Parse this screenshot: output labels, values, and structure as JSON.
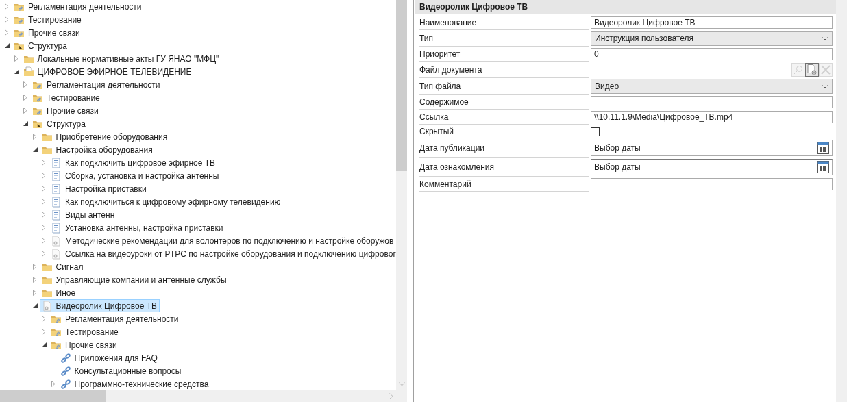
{
  "tree": [
    {
      "label": "Регламентация деятельности",
      "kind": "folder-link",
      "expandable": true,
      "expanded": false,
      "selected": false
    },
    {
      "label": "Тестирование",
      "kind": "folder-link",
      "expandable": true,
      "expanded": false,
      "selected": false
    },
    {
      "label": "Прочие связи",
      "kind": "folder-link",
      "expandable": true,
      "expanded": false,
      "selected": false
    },
    {
      "label": "Структура",
      "kind": "folder-struct",
      "expandable": true,
      "expanded": true,
      "selected": false,
      "children": [
        {
          "label": "Локальные нормативные акты ГУ ЯНАО \"МФЦ\"",
          "kind": "folder",
          "expandable": true,
          "expanded": false,
          "selected": false
        },
        {
          "label": "ЦИФРОВОЕ ЭФИРНОЕ ТЕЛЕВИДЕНИЕ",
          "kind": "folder-doc",
          "expandable": true,
          "expanded": true,
          "selected": false,
          "children": [
            {
              "label": "Регламентация деятельности",
              "kind": "folder-link",
              "expandable": true,
              "expanded": false,
              "selected": false
            },
            {
              "label": "Тестирование",
              "kind": "folder-link",
              "expandable": true,
              "expanded": false,
              "selected": false
            },
            {
              "label": "Прочие связи",
              "kind": "folder-link",
              "expandable": true,
              "expanded": false,
              "selected": false
            },
            {
              "label": "Структура",
              "kind": "folder-struct",
              "expandable": true,
              "expanded": true,
              "selected": false,
              "children": [
                {
                  "label": "Приобретение оборудования",
                  "kind": "folder",
                  "expandable": true,
                  "expanded": false,
                  "selected": false
                },
                {
                  "label": "Настройка оборудования",
                  "kind": "folder",
                  "expandable": true,
                  "expanded": true,
                  "selected": false,
                  "children": [
                    {
                      "label": "Как подключить цифровое эфирное ТВ",
                      "kind": "document",
                      "expandable": true,
                      "expanded": false,
                      "selected": false
                    },
                    {
                      "label": "Сборка, установка и настройка антенны",
                      "kind": "document",
                      "expandable": true,
                      "expanded": false,
                      "selected": false
                    },
                    {
                      "label": "Настройка приставки",
                      "kind": "document",
                      "expandable": true,
                      "expanded": false,
                      "selected": false
                    },
                    {
                      "label": "Как подключиться к цифровому эфирному телевидению",
                      "kind": "document",
                      "expandable": true,
                      "expanded": false,
                      "selected": false
                    },
                    {
                      "label": "Виды антенн",
                      "kind": "document",
                      "expandable": true,
                      "expanded": false,
                      "selected": false
                    },
                    {
                      "label": "Установка антенны, настройка приставки",
                      "kind": "document",
                      "expandable": true,
                      "expanded": false,
                      "selected": false
                    },
                    {
                      "label": "Методические рекомендации для волонтеров по подключению и настройке оборужов",
                      "kind": "media",
                      "expandable": true,
                      "expanded": false,
                      "selected": false
                    },
                    {
                      "label": "Ссылка на видеоуроки от РТРС по настройке оборудования и подключению цифровог",
                      "kind": "media",
                      "expandable": true,
                      "expanded": false,
                      "selected": false
                    }
                  ]
                },
                {
                  "label": "Сигнал",
                  "kind": "folder",
                  "expandable": true,
                  "expanded": false,
                  "selected": false
                },
                {
                  "label": "Управляющие компании и антенные службы",
                  "kind": "folder",
                  "expandable": true,
                  "expanded": false,
                  "selected": false
                },
                {
                  "label": "Иное",
                  "kind": "folder",
                  "expandable": true,
                  "expanded": false,
                  "selected": false
                },
                {
                  "label": "Видеоролик Цифровое ТВ",
                  "kind": "media",
                  "expandable": true,
                  "expanded": true,
                  "selected": true,
                  "children": [
                    {
                      "label": "Регламентация деятельности",
                      "kind": "folder-link",
                      "expandable": true,
                      "expanded": false,
                      "selected": false
                    },
                    {
                      "label": "Тестирование",
                      "kind": "folder-link",
                      "expandable": true,
                      "expanded": false,
                      "selected": false
                    },
                    {
                      "label": "Прочие связи",
                      "kind": "folder-link",
                      "expandable": true,
                      "expanded": true,
                      "selected": false,
                      "children": [
                        {
                          "label": "Приложения для FAQ",
                          "kind": "link",
                          "expandable": false,
                          "selected": false
                        },
                        {
                          "label": "Консультационные вопросы",
                          "kind": "link",
                          "expandable": false,
                          "selected": false
                        },
                        {
                          "label": "Программно-технические средства",
                          "kind": "link",
                          "expandable": true,
                          "expanded": false,
                          "selected": false
                        }
                      ]
                    }
                  ]
                }
              ]
            }
          ]
        }
      ]
    }
  ],
  "details": {
    "title": "Видеоролик Цифровое ТВ",
    "fields": [
      {
        "label": "Наименование",
        "kind": "text",
        "value": "Видеоролик Цифровое ТВ"
      },
      {
        "label": "Тип",
        "kind": "select",
        "value": "Инструкция пользователя"
      },
      {
        "label": "Приоритет",
        "kind": "text",
        "value": "0"
      },
      {
        "label": "Файл документа",
        "kind": "file",
        "buttons": [
          {
            "kind": "search",
            "disabled": true
          },
          {
            "kind": "new-file",
            "disabled": false
          },
          {
            "kind": "delete",
            "disabled": true
          }
        ]
      },
      {
        "label": "Тип файла",
        "kind": "select",
        "value": "Видео"
      },
      {
        "label": "Содержимое",
        "kind": "text"
      },
      {
        "label": "Ссылка",
        "kind": "text",
        "value": "\\\\10.11.1.9\\Media\\Цифровое_ТВ.mp4"
      },
      {
        "label": "Скрытый",
        "kind": "checkbox",
        "checked": false
      },
      {
        "label": "Дата публикации",
        "kind": "date",
        "placeholder": "Выбор даты"
      },
      {
        "label": "Дата ознакомления",
        "kind": "date",
        "placeholder": "Выбор даты"
      },
      {
        "label": "Комментарий",
        "kind": "text"
      }
    ]
  }
}
